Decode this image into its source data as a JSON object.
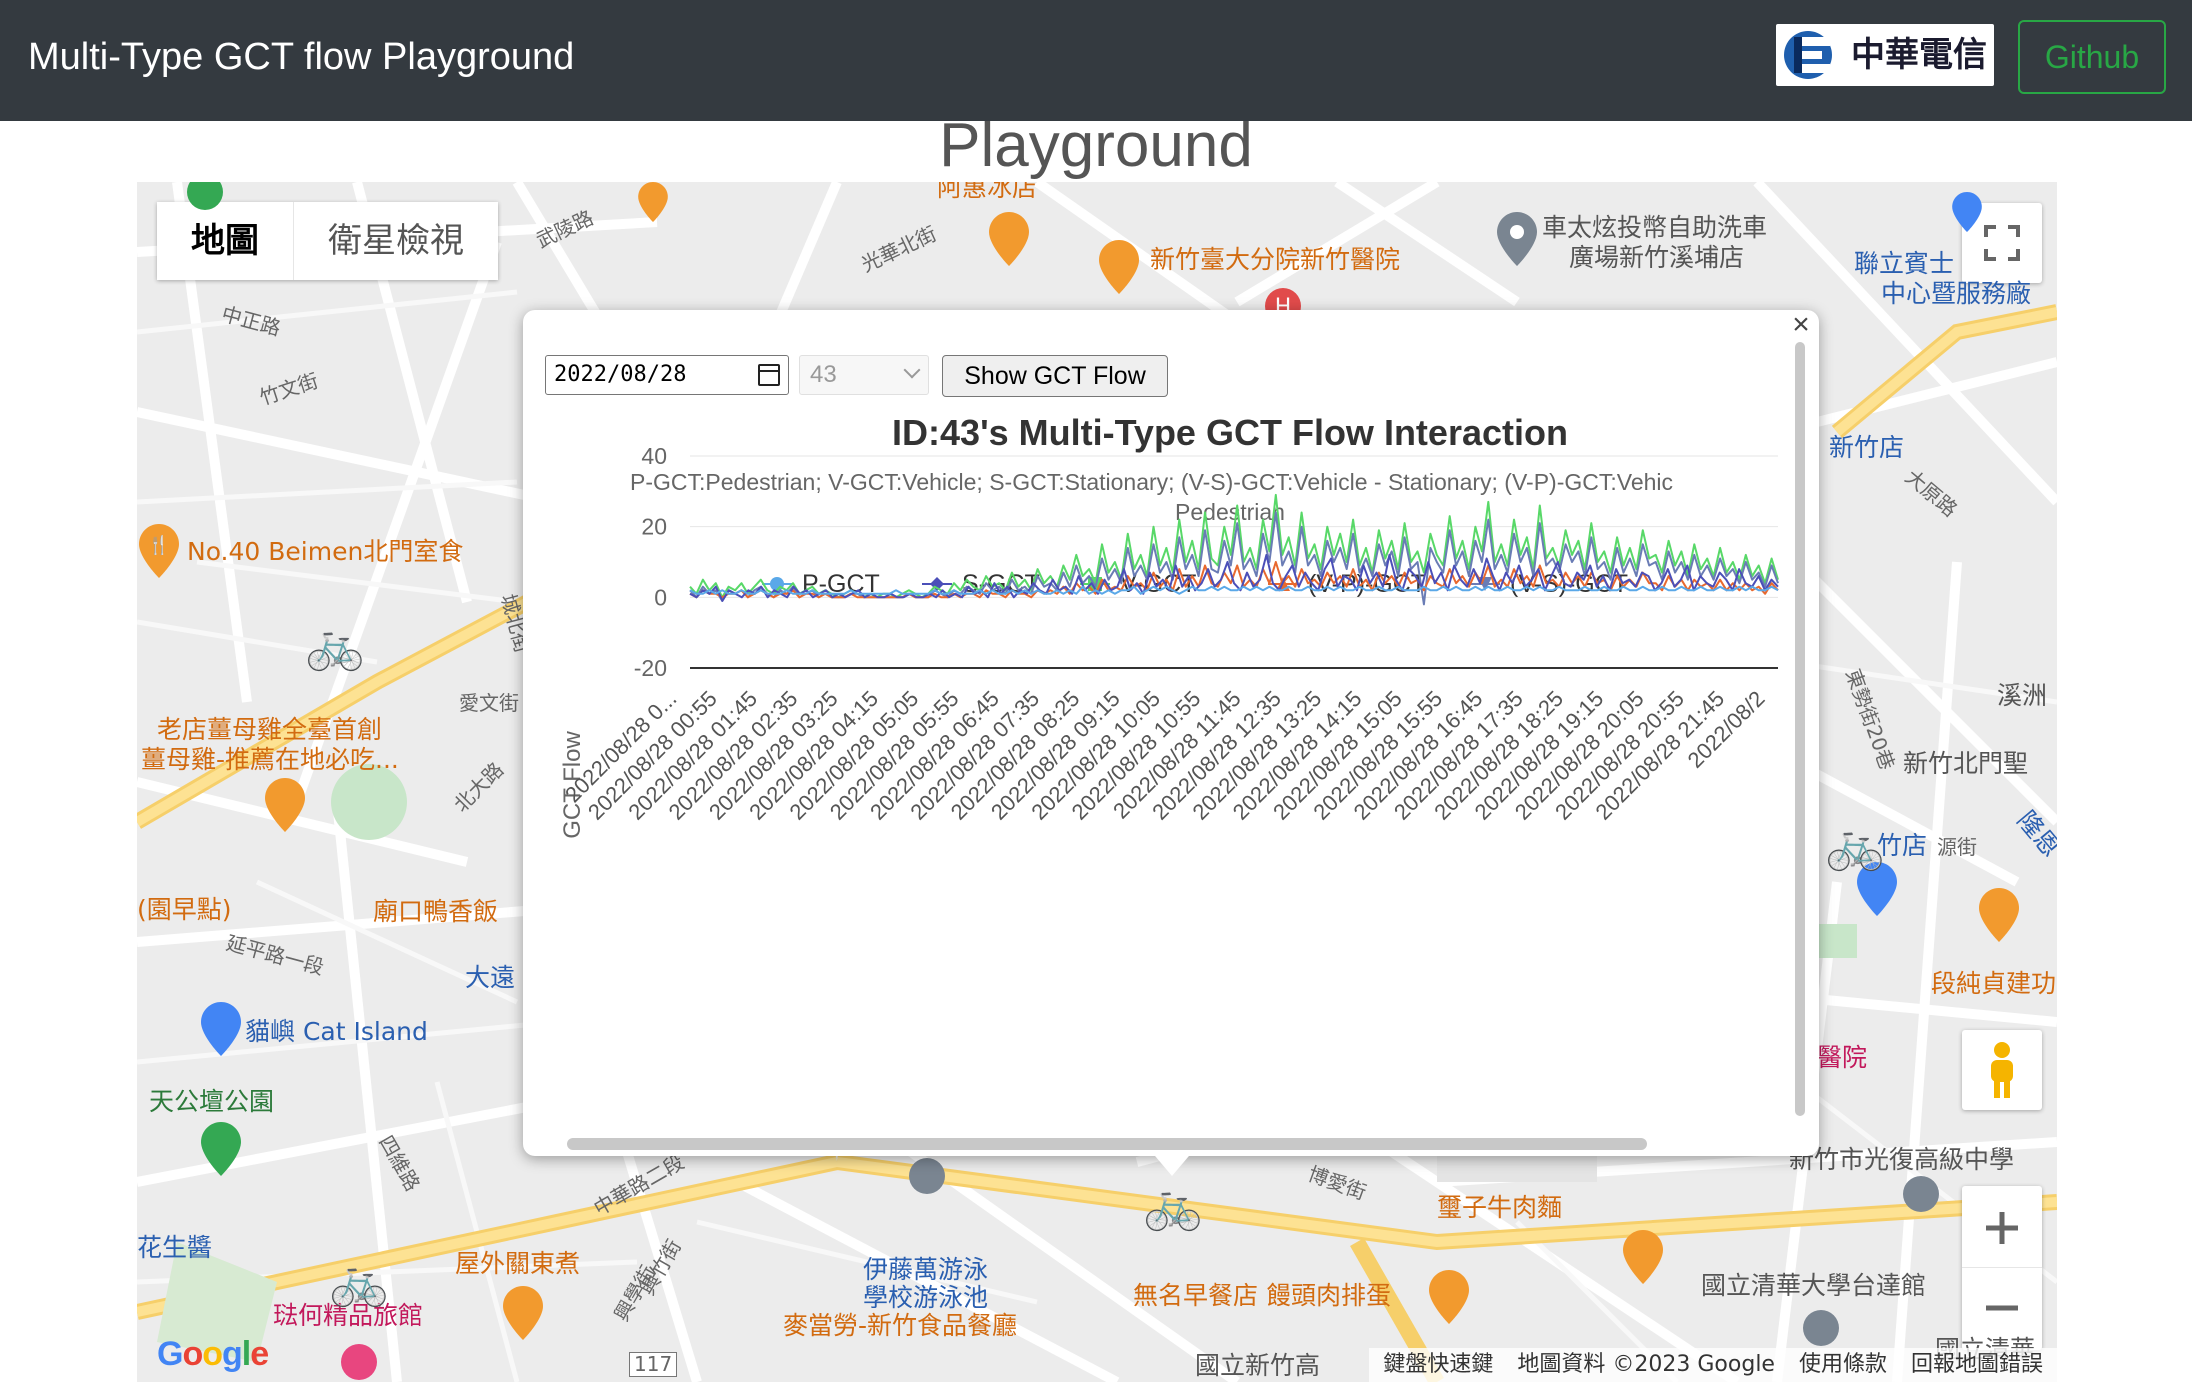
{
  "navbar": {
    "brand": "Multi-Type GCT flow Playground",
    "logo_text": "中華電信",
    "github_label": "Github"
  },
  "page_heading": "Playground",
  "map": {
    "view_tabs": [
      "地圖",
      "衛星檢視"
    ],
    "labels": {
      "a_hui": "阿惠冰店",
      "guangfu_n": "光華北街",
      "hospital": "新竹臺大分院新竹醫院",
      "hotel_car": "車太炫投幣自助洗車",
      "hotel_car2": "廣場新竹溪埔店",
      "lianli": "聯立賓士",
      "lianli2": "中心暨服務廠",
      "wuling": "武陵路",
      "zhongzheng": "中正路",
      "zhuwen": "竹文街",
      "no40": "No.40 Beimen北門室食",
      "muji": "老店薑母雞全臺首創",
      "muji2": "薑母雞-推薦在地必吃...",
      "chengbei": "城北街",
      "aiwen": "愛文街",
      "beida": "北大路",
      "yuanzao": "(園早點)",
      "miaokou": "廟口鴨香飯",
      "yanping": "延平路一段",
      "dayuan": "大遠",
      "cat_island": "貓嶼 Cat Island",
      "tiangong": "天公壇公園",
      "siwei": "四維路",
      "huasheng": "花生醬",
      "xinzhu_dian": "新竹店",
      "daxue": "大原路",
      "xizhou": "溪洲",
      "dongshi": "東勢街20巷",
      "beimen_sheng": "新竹北門聖",
      "zhudian": "竹店",
      "yuan": "源街",
      "longen": "隆恩",
      "duan": "段純貞建功",
      "yiyuan": "醫院",
      "guangfu_hs": "新竹市光復高級中學",
      "zhonghua": "中華路二段",
      "boai": "博愛街",
      "beef": "璽子牛肉麵",
      "wuming": "無名早餐店 饅頭肉排蛋",
      "outdoor": "屋外關東煮",
      "itoman": "伊藤萬游泳",
      "itoman2": "學校游泳池",
      "mcd": "麥當勞-新竹食品餐廳",
      "qinghua": "國立清華大學台達館",
      "hotel": "琺何精品旅館",
      "xinzhu_high": "國立新竹高",
      "qingcheng": "國立清華",
      "road117": "117",
      "xingzhu": "興竹街",
      "xinxue": "興學街"
    },
    "attribution": [
      "鍵盤快速鍵",
      "地圖資料 ©2023 Google",
      "使用條款",
      "回報地圖錯誤"
    ],
    "google_logo": "Google"
  },
  "info_window": {
    "close_symbol": "×",
    "date_value": "2022/08/28",
    "id_value": "43",
    "show_button": "Show GCT Flow"
  },
  "chart_data": {
    "type": "line",
    "title": "ID:43's Multi-Type GCT Flow Interaction",
    "subtitle_line1": "P-GCT:Pedestrian; V-GCT:Vehicle; S-GCT:Stationary; (V-S)-GCT:Vehicle - Stationary; (V-P)-GCT:Vehic",
    "subtitle_line2": "Pedestrian",
    "ylabel": "GCT Flow",
    "xlabel": "",
    "ylim": [
      -20,
      40
    ],
    "yticks": [
      40,
      20,
      0,
      -20
    ],
    "legend_position": "top",
    "x_tick_labels": [
      "2022/08/28 0...",
      "2022/08/28 00:55",
      "2022/08/28 01:45",
      "2022/08/28 02:35",
      "2022/08/28 03:25",
      "2022/08/28 04:15",
      "2022/08/28 05:05",
      "2022/08/28 05:55",
      "2022/08/28 06:45",
      "2022/08/28 07:35",
      "2022/08/28 08:25",
      "2022/08/28 09:15",
      "2022/08/28 10:05",
      "2022/08/28 10:55",
      "2022/08/28 11:45",
      "2022/08/28 12:35",
      "2022/08/28 13:25",
      "2022/08/28 14:15",
      "2022/08/28 15:05",
      "2022/08/28 15:55",
      "2022/08/28 16:45",
      "2022/08/28 17:35",
      "2022/08/28 18:25",
      "2022/08/28 19:15",
      "2022/08/28 20:05",
      "2022/08/28 20:55",
      "2022/08/28 21:45",
      "2022/08/2"
    ],
    "series": [
      {
        "name": "P-GCT",
        "color": "#5aa8e8",
        "marker": "circle",
        "values": [
          2,
          1,
          1,
          2,
          1,
          2,
          1,
          1,
          2,
          1,
          1,
          2,
          1,
          1,
          1,
          2,
          1,
          1,
          1,
          2,
          1,
          1,
          1,
          1,
          1,
          2,
          1,
          1,
          1,
          1,
          1,
          1,
          2,
          1,
          1,
          1,
          1,
          1,
          2,
          1,
          1,
          2,
          1,
          1,
          1,
          2,
          1,
          2,
          1,
          1,
          2,
          1,
          2,
          1,
          2,
          1,
          1,
          2,
          1,
          2,
          1,
          3,
          1,
          2,
          1,
          2,
          1,
          2,
          2,
          3,
          1,
          2,
          3,
          2,
          3,
          2,
          1,
          2,
          3,
          2,
          2,
          3,
          2,
          3,
          2,
          2,
          3,
          2,
          3,
          2,
          3,
          2,
          2,
          3,
          2,
          2,
          3,
          2,
          2,
          3,
          2,
          3,
          2,
          2,
          3,
          2,
          2,
          3,
          2,
          2,
          3,
          2,
          2,
          2,
          3,
          2,
          2,
          3,
          2,
          3,
          2,
          2,
          3,
          2,
          3,
          2,
          2,
          3,
          2,
          2,
          3,
          2,
          3,
          2,
          2,
          3,
          2,
          2,
          2,
          3,
          2,
          2,
          3,
          2,
          2,
          3,
          2,
          2,
          3,
          2,
          2,
          3,
          2,
          2,
          3,
          2,
          2,
          3,
          2,
          2,
          3,
          2,
          2,
          3,
          2,
          3,
          2,
          2,
          3,
          2
        ]
      },
      {
        "name": "S-GCT",
        "color": "#4b4fb8",
        "marker": "diamond",
        "values": [
          1,
          0,
          2,
          1,
          3,
          -1,
          2,
          1,
          0,
          2,
          1,
          3,
          0,
          2,
          1,
          0,
          3,
          1,
          2,
          0,
          1,
          2,
          0,
          1,
          0,
          1,
          2,
          0,
          1,
          0,
          0,
          1,
          0,
          0,
          1,
          0,
          0,
          1,
          0,
          2,
          0,
          1,
          0,
          3,
          1,
          2,
          0,
          4,
          1,
          3,
          0,
          2,
          1,
          4,
          2,
          1,
          5,
          2,
          3,
          1,
          6,
          2,
          4,
          1,
          5,
          2,
          3,
          8,
          2,
          4,
          1,
          7,
          3,
          5,
          2,
          9,
          3,
          6,
          2,
          4,
          8,
          3,
          5,
          10,
          4,
          2,
          7,
          3,
          5,
          12,
          4,
          2,
          6,
          9,
          3,
          7,
          4,
          2,
          8,
          11,
          3,
          6,
          5,
          2,
          9,
          4,
          7,
          3,
          12,
          5,
          2,
          8,
          6,
          3,
          10,
          4,
          7,
          2,
          9,
          5,
          3,
          8,
          4,
          11,
          6,
          2,
          7,
          4,
          9,
          3,
          5,
          8,
          2,
          6,
          10,
          4,
          3,
          7,
          5,
          9,
          3,
          6,
          2,
          8,
          4,
          5,
          3,
          7,
          6,
          2,
          4,
          8,
          3,
          5,
          9,
          2,
          6,
          4,
          3,
          7,
          5,
          2,
          8,
          4,
          3,
          6,
          2,
          5,
          3
        ]
      },
      {
        "name": "V-GCT",
        "color": "#58d868",
        "marker": "square",
        "values": [
          3,
          1,
          5,
          2,
          4,
          0,
          3,
          2,
          4,
          1,
          3,
          5,
          2,
          1,
          3,
          2,
          4,
          1,
          2,
          3,
          1,
          2,
          1,
          0,
          1,
          2,
          1,
          0,
          1,
          0,
          1,
          1,
          0,
          1,
          2,
          1,
          0,
          1,
          3,
          2,
          1,
          4,
          2,
          5,
          3,
          2,
          6,
          3,
          4,
          2,
          7,
          3,
          5,
          2,
          8,
          4,
          6,
          3,
          9,
          5,
          12,
          6,
          8,
          4,
          15,
          7,
          10,
          5,
          18,
          8,
          12,
          6,
          20,
          9,
          14,
          7,
          22,
          10,
          16,
          8,
          24,
          11,
          9,
          20,
          12,
          26,
          10,
          14,
          8,
          22,
          13,
          29,
          12,
          17,
          9,
          24,
          11,
          15,
          8,
          20,
          12,
          18,
          10,
          22,
          9,
          14,
          7,
          19,
          11,
          16,
          8,
          21,
          10,
          13,
          7,
          18,
          12,
          9,
          23,
          11,
          16,
          8,
          20,
          13,
          27,
          10,
          15,
          9,
          22,
          12,
          17,
          8,
          26,
          11,
          14,
          9,
          19,
          12,
          16,
          8,
          21,
          10,
          13,
          7,
          17,
          9,
          14,
          8,
          19,
          11,
          12,
          7,
          16,
          9,
          13,
          6,
          15,
          8,
          11,
          6,
          14,
          7,
          10,
          5,
          12,
          6,
          9,
          4,
          11,
          5
        ]
      },
      {
        "name": "(V-P)-GCT",
        "color": "#e8692f",
        "marker": "triangle-up",
        "values": [
          1,
          0,
          2,
          1,
          1,
          0,
          1,
          1,
          2,
          0,
          1,
          2,
          1,
          0,
          1,
          1,
          2,
          0,
          1,
          1,
          0,
          1,
          0,
          0,
          0,
          1,
          0,
          0,
          0,
          0,
          0,
          0,
          0,
          0,
          1,
          0,
          0,
          0,
          1,
          0,
          0,
          1,
          0,
          1,
          1,
          0,
          2,
          1,
          1,
          0,
          2,
          1,
          1,
          0,
          2,
          1,
          2,
          1,
          3,
          1,
          4,
          2,
          3,
          1,
          5,
          2,
          3,
          2,
          6,
          3,
          4,
          2,
          7,
          3,
          5,
          2,
          8,
          3,
          6,
          3,
          9,
          4,
          3,
          7,
          4,
          9,
          3,
          5,
          3,
          8,
          4,
          10,
          4,
          6,
          3,
          8,
          4,
          5,
          3,
          7,
          4,
          6,
          3,
          8,
          3,
          5,
          2,
          7,
          4,
          6,
          3,
          7,
          4,
          5,
          2,
          6,
          4,
          3,
          8,
          4,
          6,
          3,
          7,
          4,
          9,
          3,
          5,
          3,
          8,
          4,
          6,
          3,
          9,
          4,
          5,
          3,
          7,
          4,
          6,
          3,
          7,
          4,
          5,
          2,
          6,
          3,
          5,
          3,
          7,
          4,
          4,
          2,
          6,
          3,
          5,
          2,
          5,
          3,
          4,
          2,
          5,
          2,
          4,
          2,
          4,
          2,
          3,
          1,
          4,
          2
        ]
      },
      {
        "name": "(V-S)-GCT",
        "color": "#6a7cb5",
        "marker": "triangle-down",
        "values": [
          2,
          0,
          3,
          1,
          2,
          -1,
          2,
          1,
          2,
          0,
          2,
          3,
          1,
          0,
          2,
          1,
          3,
          0,
          1,
          2,
          0,
          1,
          0,
          0,
          0,
          1,
          1,
          0,
          0,
          0,
          0,
          0,
          0,
          0,
          1,
          0,
          0,
          0,
          2,
          1,
          0,
          2,
          1,
          3,
          2,
          1,
          4,
          2,
          3,
          1,
          5,
          2,
          3,
          1,
          6,
          3,
          4,
          2,
          7,
          3,
          9,
          4,
          6,
          3,
          11,
          5,
          8,
          4,
          14,
          6,
          9,
          5,
          15,
          7,
          10,
          5,
          17,
          8,
          12,
          6,
          19,
          8,
          7,
          16,
          9,
          21,
          8,
          11,
          6,
          18,
          10,
          24,
          9,
          13,
          7,
          20,
          9,
          12,
          6,
          16,
          10,
          14,
          8,
          18,
          7,
          11,
          6,
          15,
          9,
          13,
          6,
          17,
          8,
          10,
          -2,
          14,
          10,
          7,
          19,
          9,
          13,
          6,
          16,
          10,
          22,
          8,
          12,
          7,
          18,
          10,
          14,
          6,
          21,
          9,
          11,
          7,
          15,
          10,
          13,
          6,
          17,
          8,
          10,
          5,
          14,
          7,
          11,
          6,
          15,
          9,
          10,
          5,
          13,
          7,
          10,
          5,
          12,
          6,
          9,
          5,
          11,
          6,
          8,
          4,
          10,
          5,
          7,
          3,
          9,
          4
        ]
      }
    ]
  }
}
